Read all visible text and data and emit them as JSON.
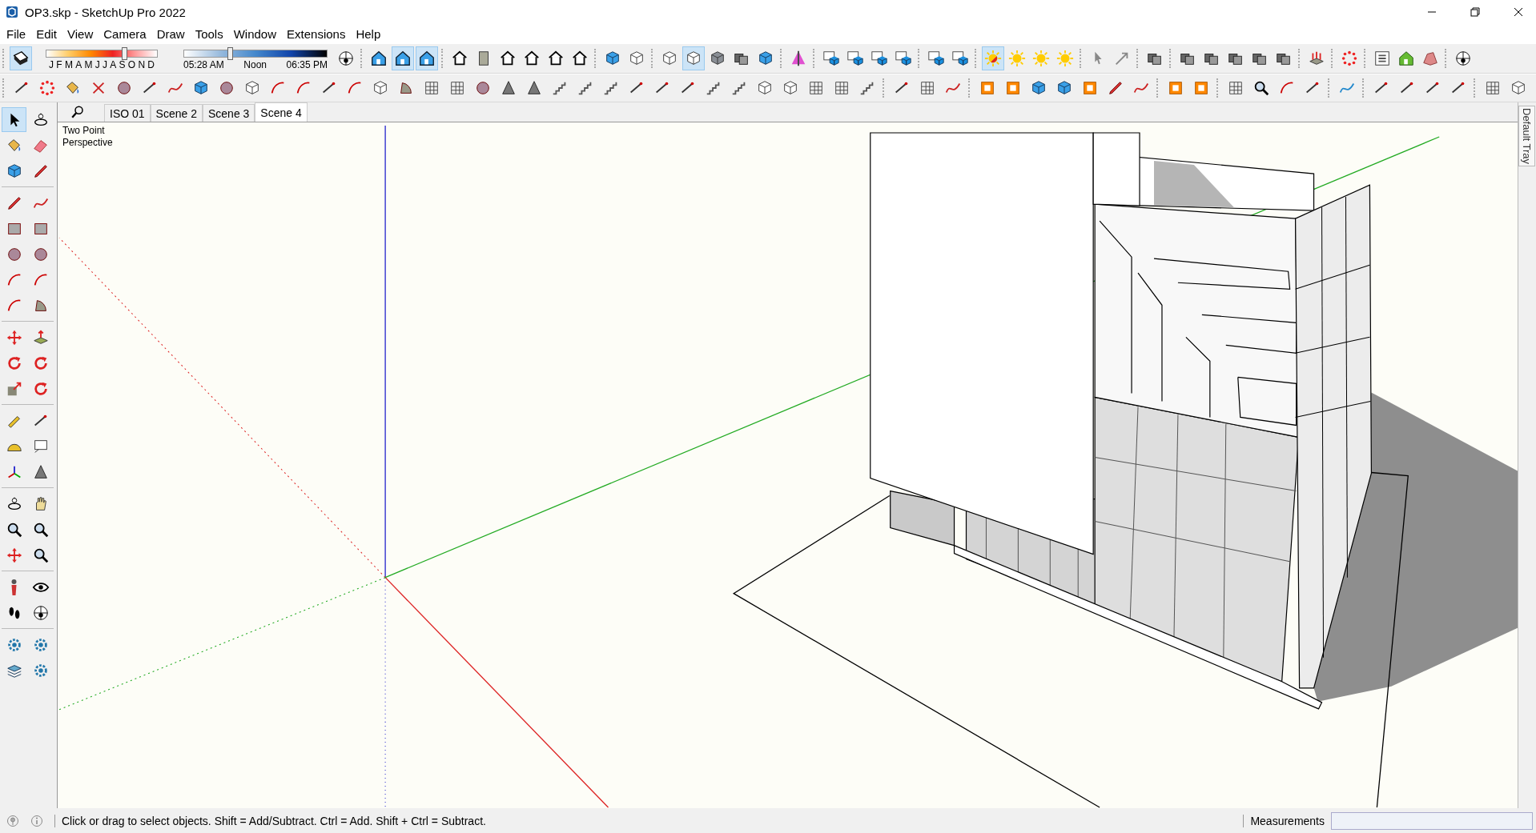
{
  "window": {
    "title": "OP3.skp - SketchUp Pro 2022"
  },
  "menu": [
    "File",
    "Edit",
    "View",
    "Camera",
    "Draw",
    "Tools",
    "Window",
    "Extensions",
    "Help"
  ],
  "shadows": {
    "selected": true,
    "month_slider": {
      "level": 0.7
    },
    "months": [
      "J",
      "F",
      "M",
      "A",
      "M",
      "J",
      "J",
      "A",
      "S",
      "O",
      "N",
      "D"
    ],
    "time_slider": {
      "level": 0.32
    },
    "times": [
      "05:28 AM",
      "Noon",
      "06:35 PM"
    ]
  },
  "toolbar": [
    {
      "selected": false
    },
    {
      "selected": false
    },
    {
      "selected": true
    },
    {
      "selected": true
    },
    {
      "selected": false
    },
    {
      "selected": false
    },
    {
      "selected": false
    },
    {
      "selected": false
    },
    {
      "selected": false
    },
    {
      "selected": false
    },
    {
      "selected": false
    },
    {
      "selected": false
    },
    {
      "selected": false
    },
    {
      "selected": true
    },
    {
      "selected": false
    },
    {
      "selected": false
    },
    {
      "selected": false
    },
    {
      "selected": false
    },
    {
      "selected": false
    },
    {
      "selected": false
    },
    {
      "selected": false
    },
    {
      "selected": false
    },
    {
      "selected": false
    },
    {
      "selected": false
    },
    {
      "selected": true
    },
    {
      "selected": false
    },
    {
      "selected": false
    },
    {
      "selected": false
    },
    {
      "selected": false
    },
    {
      "selected": false
    },
    {
      "selected": false
    },
    {
      "selected": false
    },
    {
      "selected": false
    },
    {
      "selected": false
    },
    {
      "selected": false
    },
    {
      "selected": false
    },
    {
      "selected": false
    },
    {
      "selected": false
    },
    {
      "selected": false
    },
    {
      "selected": false
    },
    {
      "selected": false
    },
    {
      "selected": false
    }
  ],
  "tools": [
    {
      "selected": true
    },
    {
      "selected": false
    },
    {
      "selected": false
    },
    {
      "selected": false
    },
    {
      "selected": false
    },
    {
      "selected": false
    },
    {
      "selected": false
    },
    {
      "selected": false
    },
    {
      "selected": false
    },
    {
      "selected": false
    },
    {
      "selected": false
    },
    {
      "selected": false
    },
    {
      "selected": false
    },
    {
      "selected": false
    },
    {
      "selected": false
    },
    {
      "selected": false
    },
    {
      "selected": false
    },
    {
      "selected": false
    },
    {
      "selected": false
    },
    {
      "selected": false
    },
    {
      "selected": false
    },
    {
      "selected": false
    },
    {
      "selected": false
    },
    {
      "selected": false
    },
    {
      "selected": false
    },
    {
      "selected": false
    },
    {
      "selected": false
    },
    {
      "selected": false
    },
    {
      "selected": false
    },
    {
      "selected": false
    },
    {
      "selected": false
    },
    {
      "selected": false
    },
    {
      "selected": false
    },
    {
      "selected": false
    },
    {
      "selected": false
    },
    {
      "selected": false
    },
    {
      "selected": false
    },
    {
      "selected": false
    },
    {
      "selected": false
    },
    {
      "selected": false
    },
    {
      "selected": false
    },
    {
      "selected": false
    }
  ],
  "scenes": [
    {
      "label": "ISO 01",
      "selected": false
    },
    {
      "label": "Scene 2",
      "selected": false
    },
    {
      "label": "Scene 3",
      "selected": false
    },
    {
      "label": "Scene 4",
      "selected": true
    }
  ],
  "camera_label": [
    "Two Point",
    "Perspective"
  ],
  "tray": {
    "label": "Default Tray"
  },
  "status_bar": {
    "hint": "Click or drag to select objects. Shift = Add/Subtract. Ctrl = Add. Shift + Ctrl = Subtract.",
    "measurements_label": "Measurements"
  }
}
